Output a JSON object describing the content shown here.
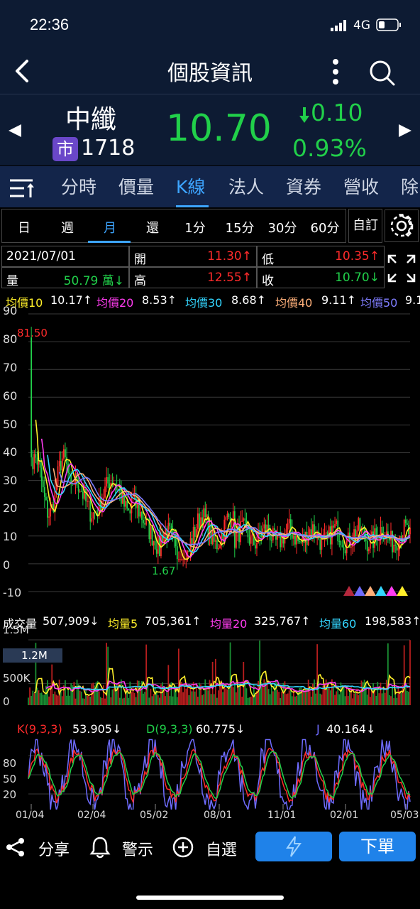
{
  "status": {
    "time": "22:36",
    "network": "4G"
  },
  "nav": {
    "title": "個股資訊"
  },
  "quote": {
    "name": "中纖",
    "market_badge": "市",
    "code": "1718",
    "price": "10.70",
    "change": "0.10",
    "change_pct": "0.93%"
  },
  "tabs": [
    "分時",
    "價量",
    "K線",
    "法人",
    "資券",
    "營收",
    "除"
  ],
  "active_tab": "K線",
  "periods": [
    "日",
    "週",
    "月",
    "還",
    "1分",
    "15分",
    "30分",
    "60分"
  ],
  "active_period": "月",
  "custom_label": "自訂",
  "ohlc": {
    "date": "2021/07/01",
    "open_label": "開",
    "open": "11.30↑",
    "low_label": "低",
    "low": "10.35↑",
    "volume_label": "量",
    "volume": "50.79 萬↓",
    "high_label": "高",
    "high": "12.55↑",
    "close_label": "收",
    "close": "10.70↓"
  },
  "ma_legend": [
    {
      "label": "均價10",
      "value": "10.17↑",
      "color": "#ffef2a"
    },
    {
      "label": "均價20",
      "value": "8.53↑",
      "color": "#ff3cf0"
    },
    {
      "label": "均價30",
      "value": "8.68↑",
      "color": "#33d6ff"
    },
    {
      "label": "均價40",
      "value": "9.11↑",
      "color": "#ffb07a"
    },
    {
      "label": "均價50",
      "value": "9.1",
      "color": "#7f7dff"
    }
  ],
  "price_chart": {
    "y_ticks": [
      "90",
      "80",
      "70",
      "60",
      "50",
      "40",
      "30",
      "20",
      "10",
      "0",
      "-10"
    ],
    "max_label": "81.50",
    "min_label": "1.67"
  },
  "volume_legend": {
    "label": "成交量",
    "value": "507,909↓",
    "ma5_label": "均量5",
    "ma5_value": "705,361↑",
    "ma20_label": "均量20",
    "ma20_value": "325,767↑",
    "ma60_label": "均量60",
    "ma60_value": "198,583↑"
  },
  "volume_chart": {
    "y_ticks": [
      "1.5M",
      "500K",
      "0"
    ],
    "hover_tag": "1.2M"
  },
  "kd_legend": {
    "k_label": "K(9,3,3)",
    "k_value": "53.905↓",
    "d_label": "D(9,3,3)",
    "d_value": "60.775↓",
    "j_label": "J",
    "j_value": "40.164↓"
  },
  "kd_chart": {
    "y_ticks": [
      "80",
      "50",
      "20"
    ]
  },
  "x_labels": [
    "01/04",
    "02/04",
    "05/02",
    "08/01",
    "11/01",
    "02/01",
    "05/03"
  ],
  "bottom": {
    "share": "分享",
    "alert": "警示",
    "watch": "自選",
    "order": "下單"
  },
  "colors": {
    "up": "#ff2b2b",
    "down": "#21d04a",
    "accent": "#3da5ff",
    "order_btn": "#1f82e9"
  }
}
